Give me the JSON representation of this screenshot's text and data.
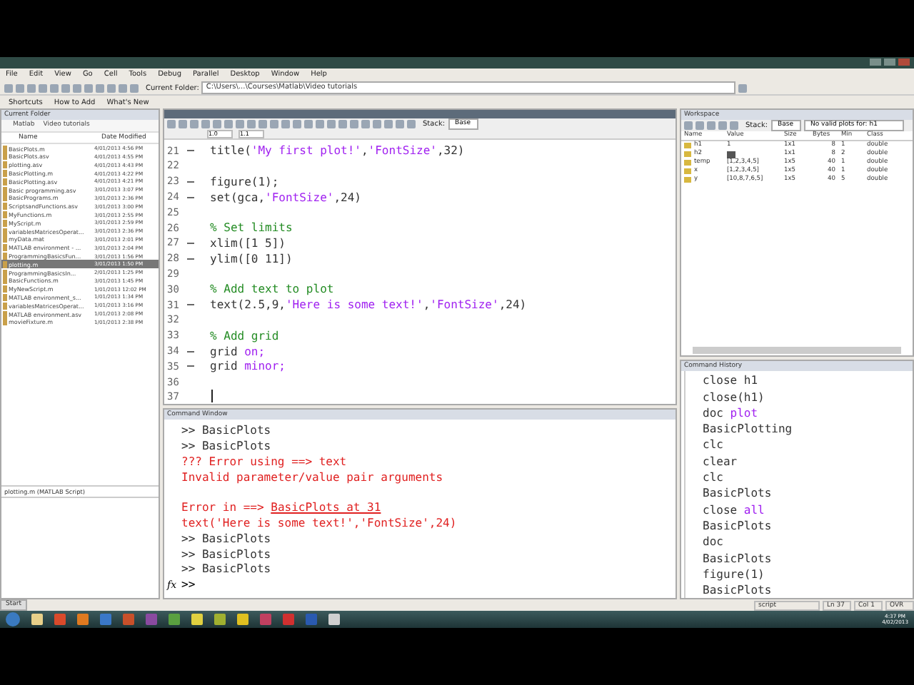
{
  "menu": [
    "File",
    "Edit",
    "View",
    "Go",
    "Cell",
    "Tools",
    "Debug",
    "Parallel",
    "Desktop",
    "Window",
    "Help"
  ],
  "toolbar": {
    "folder_label": "Current Folder:",
    "folder_path": "C:\\Users\\...\\Courses\\Matlab\\Video tutorials"
  },
  "shortcuts": [
    "Shortcuts",
    "How to Add",
    "What's New"
  ],
  "current_folder": {
    "title": "Current Folder",
    "breadcrumb": [
      "Matlab",
      "Video tutorials"
    ],
    "columns": [
      "Name",
      "Date Modified"
    ],
    "files": [
      {
        "name": "BasicPlots.m",
        "date": "4/01/2013 4:56 PM",
        "selected": false
      },
      {
        "name": "BasicPlots.asv",
        "date": "4/01/2013 4:55 PM",
        "selected": false
      },
      {
        "name": "plotting.asv",
        "date": "4/01/2013 4:43 PM",
        "selected": false
      },
      {
        "name": "BasicPlotting.m",
        "date": "4/01/2013 4:22 PM",
        "selected": false
      },
      {
        "name": "BasicPlotting.asv",
        "date": "4/01/2013 4:21 PM",
        "selected": false
      },
      {
        "name": "Basic programming.asv",
        "date": "3/01/2013 3:07 PM",
        "selected": false
      },
      {
        "name": "BasicPrograms.m",
        "date": "3/01/2013 2:36 PM",
        "selected": false
      },
      {
        "name": "ScriptsandFunctions.asv",
        "date": "3/01/2013 3:00 PM",
        "selected": false
      },
      {
        "name": "MyFunctions.m",
        "date": "3/01/2013 2:55 PM",
        "selected": false
      },
      {
        "name": "MyScript.m",
        "date": "3/01/2013 2:59 PM",
        "selected": false
      },
      {
        "name": "variablesMatricesOperat...",
        "date": "3/01/2013 2:36 PM",
        "selected": false
      },
      {
        "name": "myData.mat",
        "date": "3/01/2013 2:01 PM",
        "selected": false
      },
      {
        "name": "MATLAB environment - ...",
        "date": "3/01/2013 2:04 PM",
        "selected": false
      },
      {
        "name": "ProgrammingBasicsFun...",
        "date": "3/01/2013 1:56 PM",
        "selected": false
      },
      {
        "name": "plotting.m",
        "date": "3/01/2013 1:50 PM",
        "selected": true
      },
      {
        "name": "ProgrammingBasicsIn...",
        "date": "2/01/2013 1:25 PM",
        "selected": false
      },
      {
        "name": "BasicFunctions.m",
        "date": "3/01/2013 1:45 PM",
        "selected": false
      },
      {
        "name": "MyNewScript.m",
        "date": "1/01/2013 12:02 PM",
        "selected": false
      },
      {
        "name": "MATLAB environment_s...",
        "date": "1/01/2013 1:34 PM",
        "selected": false
      },
      {
        "name": "variablesMatricesOperat...",
        "date": "1/01/2013 3:16 PM",
        "selected": false
      },
      {
        "name": "MATLAB environment.asv",
        "date": "1/01/2013 2:08 PM",
        "selected": false
      },
      {
        "name": "movieFixture.m",
        "date": "1/01/2013 2:38 PM",
        "selected": false
      }
    ],
    "details": "plotting.m (MATLAB Script)"
  },
  "editor": {
    "stack_label": "Stack:",
    "stack_value": "Base",
    "cell_values": [
      "1.0",
      "1.1"
    ],
    "lines": [
      {
        "num": "21",
        "exec": true,
        "tokens": [
          {
            "kind": "code",
            "text": "title("
          },
          {
            "kind": "string",
            "text": "'My first plot!'"
          },
          {
            "kind": "code",
            "text": ","
          },
          {
            "kind": "string",
            "text": "'FontSize'"
          },
          {
            "kind": "code",
            "text": ",32)"
          }
        ]
      },
      {
        "num": "22",
        "exec": false
      },
      {
        "num": "23",
        "exec": true,
        "tokens": [
          {
            "kind": "code",
            "text": "figure(1);"
          }
        ]
      },
      {
        "num": "24",
        "exec": true,
        "tokens": [
          {
            "kind": "code",
            "text": "set(gca,"
          },
          {
            "kind": "string",
            "text": "'FontSize'"
          },
          {
            "kind": "code",
            "text": ",24)"
          }
        ]
      },
      {
        "num": "25",
        "exec": false
      },
      {
        "num": "26",
        "exec": false,
        "tokens": [
          {
            "kind": "comment",
            "text": "% Set limits"
          }
        ]
      },
      {
        "num": "27",
        "exec": true,
        "tokens": [
          {
            "kind": "code",
            "text": "xlim([1 5])"
          }
        ]
      },
      {
        "num": "28",
        "exec": true,
        "tokens": [
          {
            "kind": "code",
            "text": "ylim([0 11])"
          }
        ]
      },
      {
        "num": "29",
        "exec": false
      },
      {
        "num": "30",
        "exec": false,
        "tokens": [
          {
            "kind": "comment",
            "text": "% Add text to plot"
          }
        ]
      },
      {
        "num": "31",
        "exec": true,
        "tokens": [
          {
            "kind": "code",
            "text": "text(2.5,9,"
          },
          {
            "kind": "string",
            "text": "'Here is some text!'"
          },
          {
            "kind": "code",
            "text": ","
          },
          {
            "kind": "string",
            "text": "'FontSize'"
          },
          {
            "kind": "code",
            "text": ",24)"
          }
        ]
      },
      {
        "num": "32",
        "exec": false
      },
      {
        "num": "33",
        "exec": false,
        "tokens": [
          {
            "kind": "comment",
            "text": "% Add grid"
          }
        ]
      },
      {
        "num": "34",
        "exec": true,
        "tokens": [
          {
            "kind": "code",
            "text": "grid "
          },
          {
            "kind": "string",
            "text": "on;"
          }
        ]
      },
      {
        "num": "35",
        "exec": true,
        "tokens": [
          {
            "kind": "code",
            "text": "grid "
          },
          {
            "kind": "string",
            "text": "minor;"
          }
        ]
      },
      {
        "num": "36",
        "exec": false
      },
      {
        "num": "37",
        "exec": false
      }
    ]
  },
  "workspace": {
    "title": "Workspace",
    "stack_label": "Stack:",
    "stack_value": "Base",
    "plot_select": "No valid plots for: h1",
    "columns": [
      "Name",
      "Value",
      "Size",
      "Bytes",
      "Min",
      "Class"
    ],
    "rows": [
      {
        "name": "h1",
        "value": "1",
        "kind": "text",
        "size": "1x1",
        "bytes": "8",
        "min": "1",
        "class": "double"
      },
      {
        "name": "h2",
        "value": "",
        "kind": "swatch",
        "size": "1x1",
        "bytes": "8",
        "min": "2",
        "class": "double"
      },
      {
        "name": "temp",
        "value": "[1,2,3,4,5]",
        "kind": "text",
        "size": "1x5",
        "bytes": "40",
        "min": "1",
        "class": "double"
      },
      {
        "name": "x",
        "value": "[1,2,3,4,5]",
        "kind": "text",
        "size": "1x5",
        "bytes": "40",
        "min": "1",
        "class": "double"
      },
      {
        "name": "y",
        "value": "[10,8,7,6,5]",
        "kind": "text",
        "size": "1x5",
        "bytes": "40",
        "min": "5",
        "class": "double"
      }
    ]
  },
  "command_window": {
    "title": "Command Window",
    "lines": [
      {
        "tokens": [
          {
            "kind": "code",
            "text": ">> BasicPlots"
          }
        ]
      },
      {
        "tokens": [
          {
            "kind": "code",
            "text": ">> BasicPlots"
          }
        ]
      },
      {
        "tokens": [
          {
            "kind": "error",
            "text": "??? Error using ==> text"
          }
        ]
      },
      {
        "tokens": [
          {
            "kind": "error",
            "text": "Invalid parameter/value pair arguments"
          }
        ]
      },
      {
        "gap_before": true,
        "tokens": [
          {
            "kind": "error",
            "text": "Error in ==> "
          },
          {
            "kind": "link",
            "text": "BasicPlots at 31"
          }
        ]
      },
      {
        "tokens": [
          {
            "kind": "error",
            "text": "text('Here is some text!','FontSize',24)"
          }
        ]
      },
      {
        "tokens": [
          {
            "kind": "code",
            "text": ">> BasicPlots"
          }
        ]
      },
      {
        "tokens": [
          {
            "kind": "code",
            "text": ">> BasicPlots"
          }
        ]
      },
      {
        "tokens": [
          {
            "kind": "code",
            "text": ">> BasicPlots"
          }
        ]
      }
    ],
    "function_icon": "fx",
    "prompt": ">>"
  },
  "command_history": {
    "title": "Command History",
    "entries": [
      {
        "tokens": [
          {
            "kind": "code",
            "text": "close h1"
          }
        ]
      },
      {
        "tokens": [
          {
            "kind": "code",
            "text": "close(h1)"
          }
        ]
      },
      {
        "tokens": [
          {
            "kind": "code",
            "text": "doc "
          },
          {
            "kind": "string",
            "text": "plot"
          }
        ]
      },
      {
        "tokens": [
          {
            "kind": "code",
            "text": "BasicPlotting"
          }
        ]
      },
      {
        "tokens": [
          {
            "kind": "code",
            "text": "clc"
          }
        ]
      },
      {
        "tokens": [
          {
            "kind": "code",
            "text": "clear"
          }
        ]
      },
      {
        "tokens": [
          {
            "kind": "code",
            "text": "clc"
          }
        ]
      },
      {
        "tokens": [
          {
            "kind": "code",
            "text": "BasicPlots"
          }
        ]
      },
      {
        "tokens": [
          {
            "kind": "code",
            "text": "close "
          },
          {
            "kind": "string",
            "text": "all"
          }
        ]
      },
      {
        "tokens": [
          {
            "kind": "code",
            "text": "BasicPlots"
          }
        ]
      },
      {
        "tokens": [
          {
            "kind": "code",
            "text": "doc"
          }
        ]
      },
      {
        "tokens": [
          {
            "kind": "code",
            "text": "BasicPlots"
          }
        ]
      },
      {
        "tokens": [
          {
            "kind": "code",
            "text": "figure(1)"
          }
        ]
      },
      {
        "tokens": [
          {
            "kind": "code",
            "text": "BasicPlots"
          }
        ]
      }
    ]
  },
  "status_bar": {
    "start": "Start",
    "mode": "script",
    "line": "Ln  37",
    "col": "Col  1",
    "ovr": "OVR"
  },
  "taskbar": {
    "apps": [
      {
        "color": "#e8d08a"
      },
      {
        "color": "#d94a2b"
      },
      {
        "color": "#e07a20"
      },
      {
        "color": "#3a78c8"
      },
      {
        "color": "#c8502a"
      },
      {
        "color": "#8a4aa0"
      },
      {
        "color": "#5aa040"
      },
      {
        "color": "#e0d040"
      },
      {
        "color": "#a0b030"
      },
      {
        "color": "#e0c020"
      },
      {
        "color": "#c04060"
      },
      {
        "color": "#d03030"
      },
      {
        "color": "#2a5ab0"
      },
      {
        "color": "#d0d0d0"
      }
    ],
    "time": "4:37 PM",
    "date": "4/02/2013"
  }
}
